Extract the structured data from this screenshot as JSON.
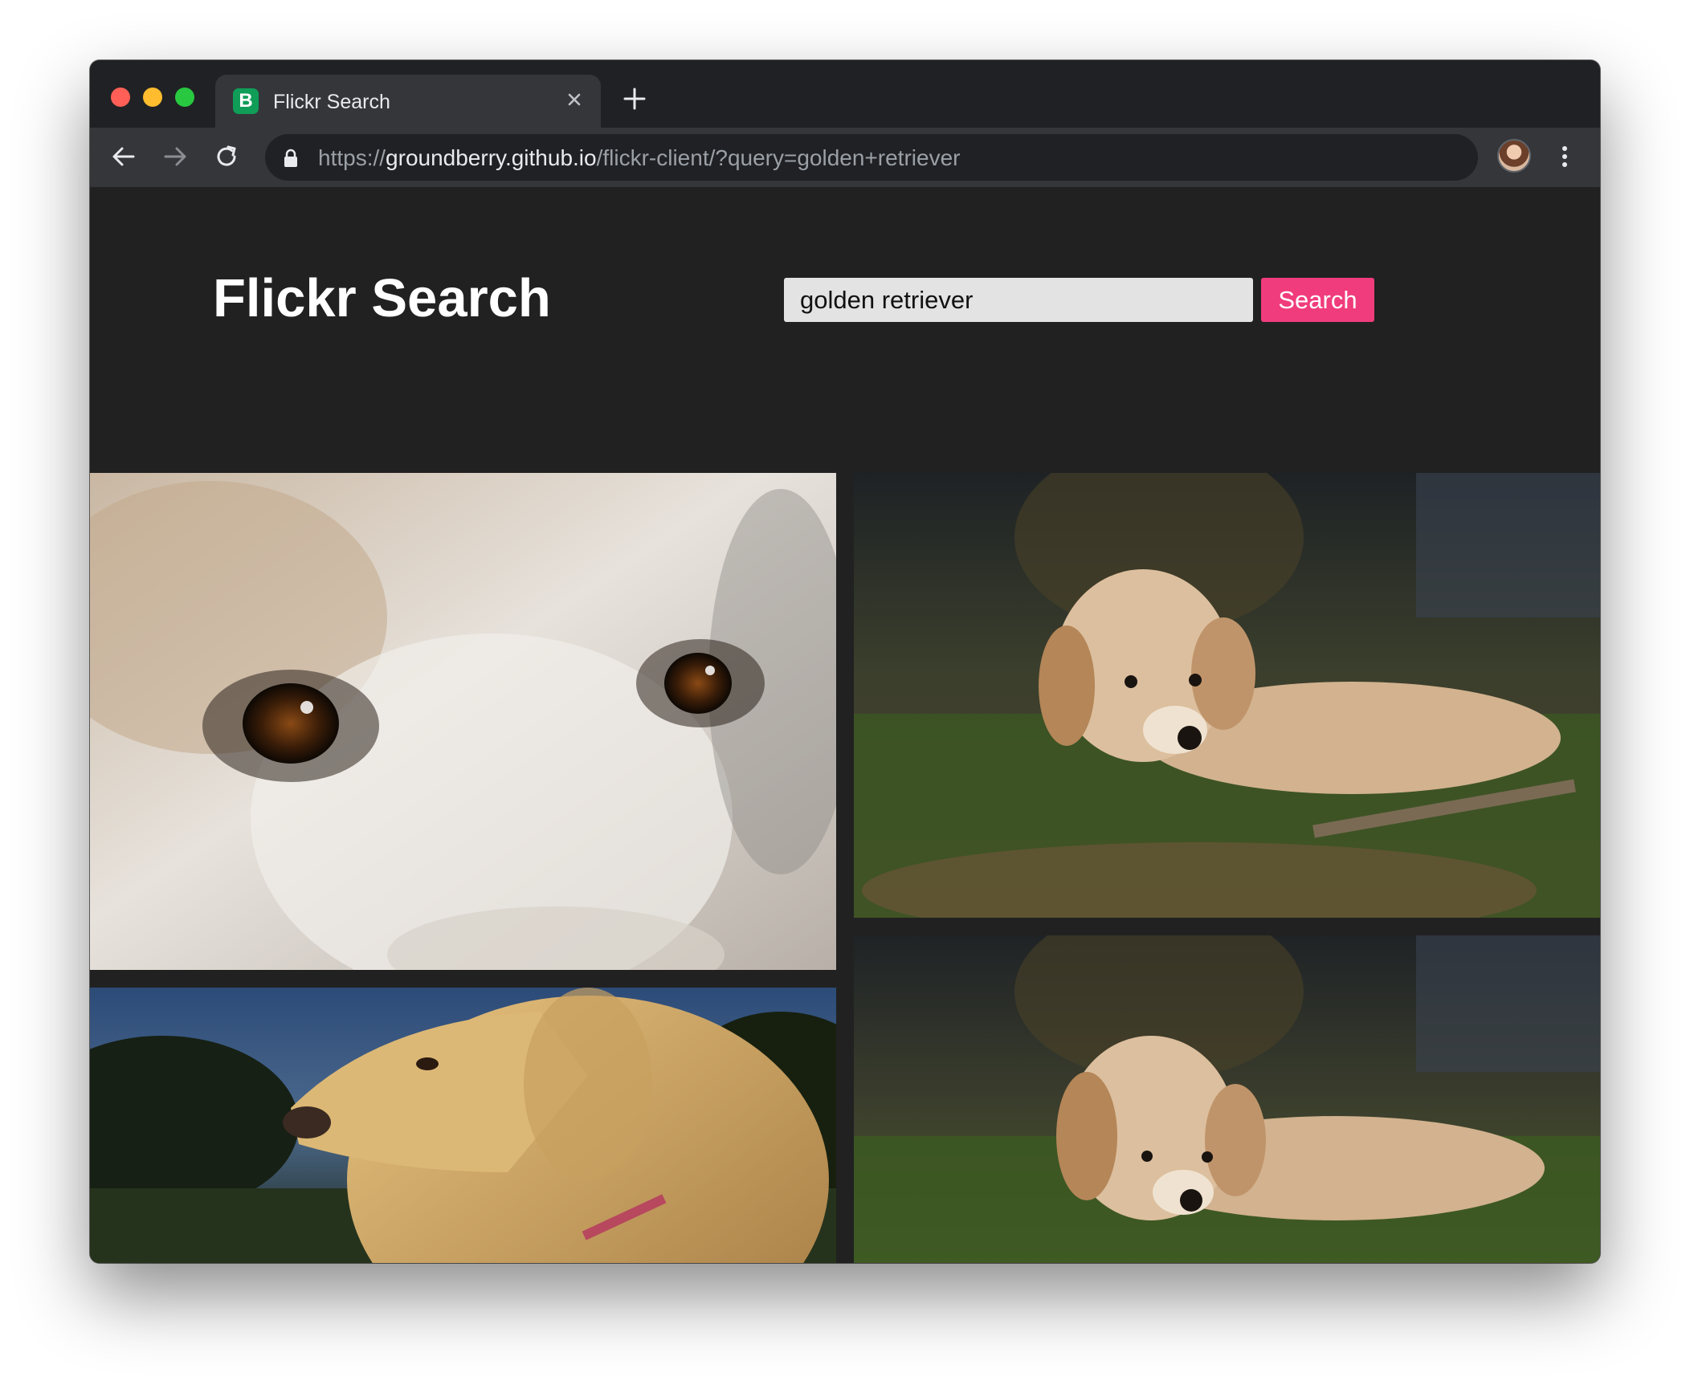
{
  "browser": {
    "tab": {
      "title": "Flickr Search",
      "favicon_letter": "B"
    },
    "url": {
      "scheme": "https://",
      "host": "groundberry.github.io",
      "path": "/flickr-client/?query=golden+retriever"
    }
  },
  "page": {
    "title": "Flickr Search",
    "search": {
      "value": "golden retriever",
      "button_label": "Search"
    }
  },
  "colors": {
    "page_bg": "#212121",
    "accent": "#f03c7c",
    "input_bg": "#e3e3e3",
    "chrome_dark": "#202124",
    "chrome_mid": "#35363a"
  },
  "icons": [
    "back-arrow-icon",
    "forward-arrow-icon",
    "reload-icon",
    "lock-icon",
    "star-icon",
    "profile-avatar",
    "more-vert-icon",
    "close-icon",
    "plus-icon"
  ]
}
